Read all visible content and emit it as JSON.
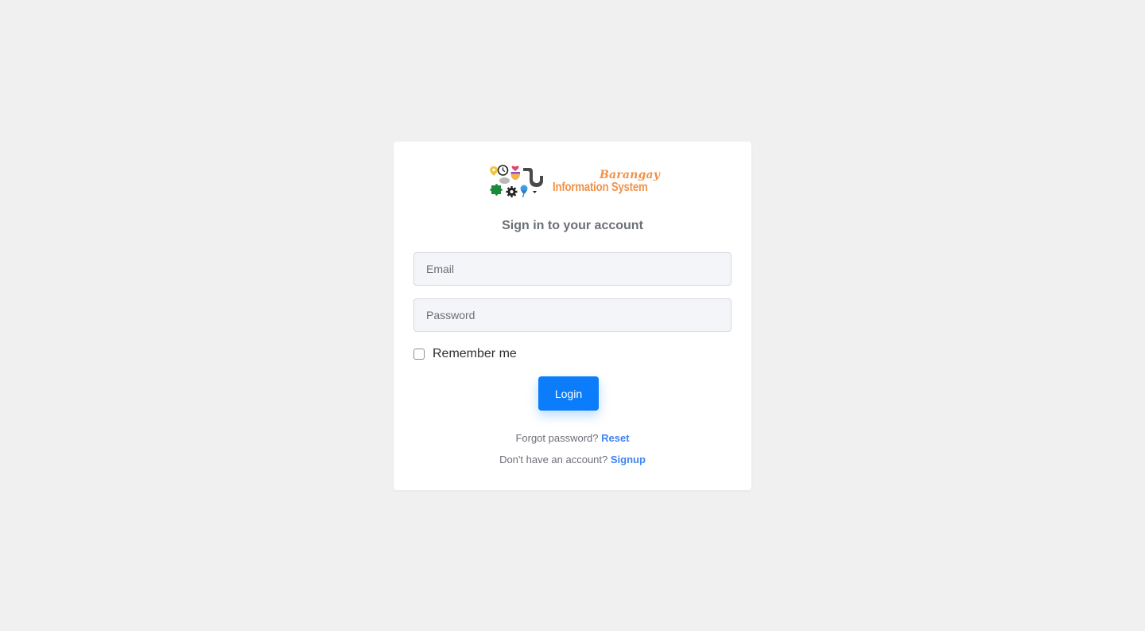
{
  "logo": {
    "line1": "Barangay",
    "line2": "Information System",
    "icons": [
      "location-pin-icon",
      "clock-icon",
      "heart-icon",
      "pipe-icon",
      "puzzle-icon",
      "gear-icon",
      "pushpin-icon",
      "mouse-icon"
    ]
  },
  "heading": "Sign in to your account",
  "email": {
    "placeholder": "Email",
    "value": ""
  },
  "password": {
    "placeholder": "Password",
    "value": ""
  },
  "remember": {
    "label": "Remember me",
    "checked": false
  },
  "login_button": "Login",
  "forgot": {
    "text": "Forgot password?",
    "link": "Reset"
  },
  "signup": {
    "text": "Don't have an account?",
    "link": "Signup"
  },
  "colors": {
    "background": "#f0f0f0",
    "card": "#ffffff",
    "primary": "#0b7dfb",
    "link": "#3f84f4",
    "logo_text": "#f0924a"
  }
}
